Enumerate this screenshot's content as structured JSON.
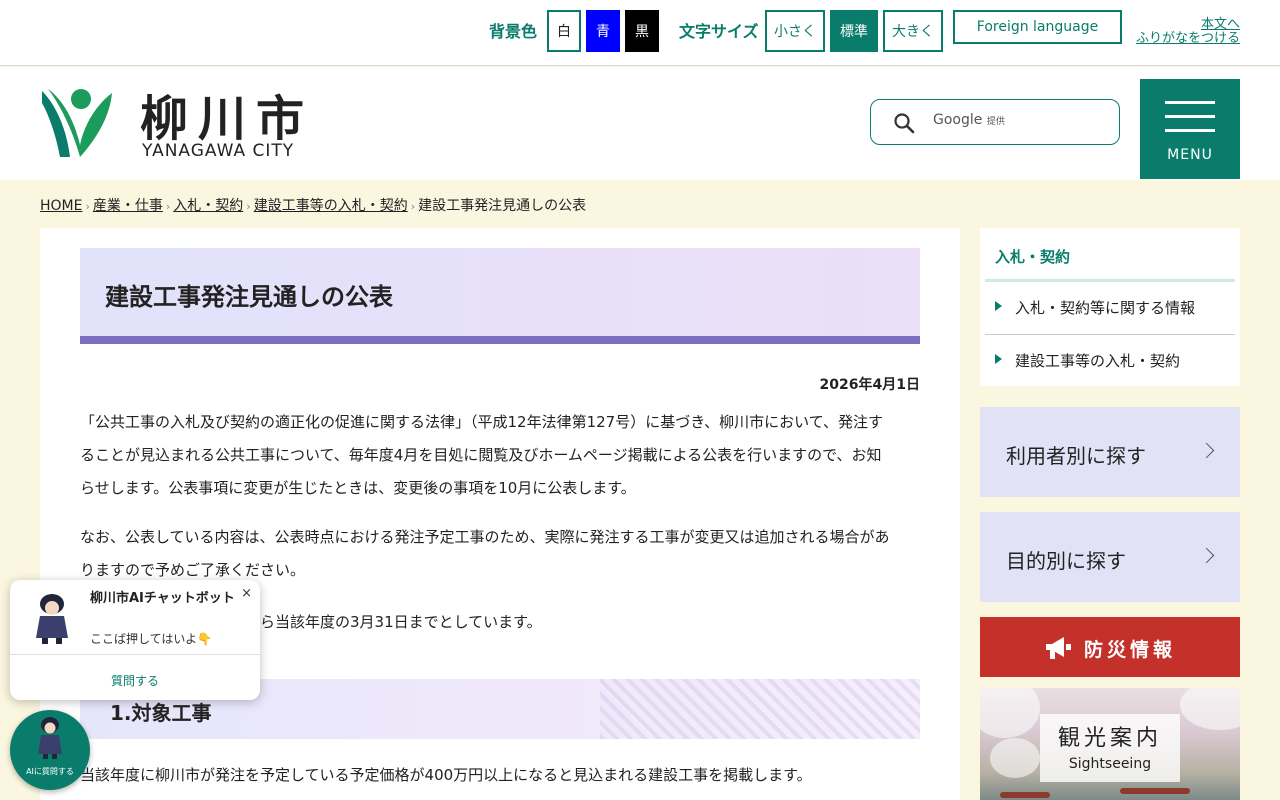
{
  "utility": {
    "bg_label": "背景色",
    "bg_white": "白",
    "bg_blue": "青",
    "bg_black": "黒",
    "fontsize_label": "文字サイズ",
    "fs_small": "小さく",
    "fs_standard": "標準",
    "fs_large": "大きく",
    "foreign": "Foreign language",
    "ruby_line1": "本文へ",
    "ruby_line2": "ふりがなをつける"
  },
  "header": {
    "logo_title": "柳川市",
    "logo_sub": "YANAGAWA CITY",
    "search_brand": "Google",
    "search_provided": "提供",
    "menu_label": "MENU"
  },
  "breadcrumb": {
    "home": "HOME",
    "c1": "産業・仕事",
    "c2": "入札・契約",
    "c3": "建設工事等の入札・契約",
    "current": "建設工事発注見通しの公表"
  },
  "main": {
    "title": "建設工事発注見通しの公表",
    "date": "2026年4月1日",
    "p1_l1": "「公共工事の入札及び契約の適正化の促進に関する法律」（平成12年法律第127号）に基づき、柳川市において、発注す",
    "p1_l2": "ることが見込まれる公共工事について、毎年度4月を目処に閲覧及びホームページ掲載による公表を行いますので、お知",
    "p1_l3": "らせします。公表事項に変更が生じたときは、変更後の事項を10月に公表します。",
    "p2_l1": "なお、公表している内容は、公表時点における発注予定工事のため、実際に発注する工事が変更又は追加される場合があ",
    "p2_l2": "りますので予めご了承ください。",
    "p3": "日から当該年度の3月31日までとしています。",
    "section1_title": "1.対象工事",
    "section1_body": "当該年度に柳川市が発注を予定している予定価格が400万円以上になると見込まれる建設工事を掲載します。"
  },
  "sidebar": {
    "local_title": "入札・契約",
    "items": [
      {
        "label": "入札・契約等に関する情報"
      },
      {
        "label": "建設工事等の入札・契約"
      }
    ],
    "find_user": "利用者別に探す",
    "find_purpose": "目的別に探す",
    "bousai": "防災情報",
    "kanko": "観光案内",
    "kanko_en": "Sightseeing"
  },
  "chat": {
    "title": "柳川市AIチャットボット",
    "subtitle": "ここば押してはいよ👇",
    "close": "×",
    "ask": "質問する",
    "fab_label": "AIに質問する"
  },
  "colors": {
    "brand_green": "#0a7c6c",
    "title_band": "#7a6fbf",
    "bousai_red": "#c4302a"
  }
}
